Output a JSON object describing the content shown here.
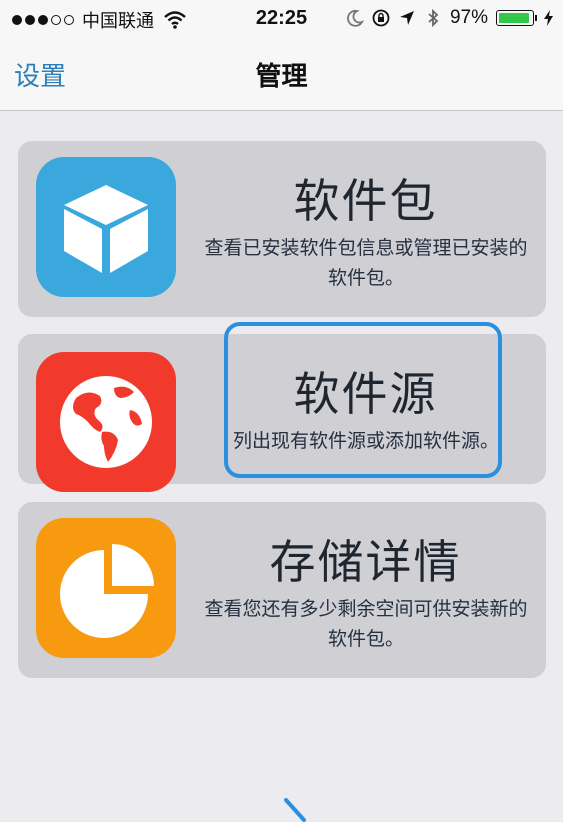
{
  "status_bar": {
    "carrier": "中国联通",
    "time": "22:25",
    "battery": "97%",
    "battery_level": 0.97,
    "colors": {
      "battery_fill": "#33c84a"
    }
  },
  "nav": {
    "back_label": "设置",
    "title": "管理"
  },
  "cards": [
    {
      "title": "软件包",
      "desc": "查看已安装软件包信息或管理已安装的软件包。",
      "icon": "package-box-icon",
      "color": "#3aa8dd"
    },
    {
      "title": "软件源",
      "desc": "列出现有软件源或添加软件源。",
      "icon": "globe-icon",
      "color": "#f23a2c"
    },
    {
      "title": "存储详情",
      "desc": "查看您还有多少剩余空间可供安装新的软件包。",
      "icon": "pie-chart-icon",
      "color": "#f79a0f"
    }
  ],
  "colors": {
    "accent": "#2c7fb8",
    "highlight": "#2b8fe0"
  }
}
